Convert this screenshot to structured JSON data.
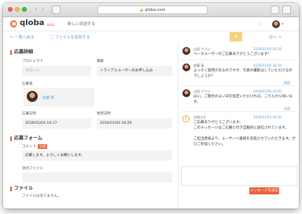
{
  "browser": {
    "url": "qloba.com"
  },
  "header": {
    "logo": "qloba",
    "beta": "beta",
    "title": "新しい対話する"
  },
  "toolbar": {
    "back_link": "← 一覧へ戻る",
    "attach_link": "🗋 ファイルを追加する",
    "next_link": "次へ >"
  },
  "detail": {
    "section_title": "応募詳細",
    "project_label": "プロジェクト",
    "project_value": "グローバ",
    "recruit_label": "募集",
    "recruit_value": "トライアルユーザーのお申し込み",
    "applicant_label": "応募者",
    "applicant_name": "佐藤 瑛",
    "applied_at_label": "応募日時",
    "applied_at_value": "2016/01/04 16:17",
    "updated_at_label": "更新日時",
    "updated_at_value": "2016/01/04 16:26"
  },
  "form": {
    "section_title": "応募フォーム",
    "comment_label": "コメント",
    "required": "必須",
    "comment_value": "応募します。よろしくお願いします。",
    "attachment_label": "添付ファイル"
  },
  "files": {
    "section_title": "ファイル",
    "empty_text": "ファイルはありません。"
  },
  "chat": {
    "messages": [
      {
        "name": "山田 ナツジ",
        "time": "2016/01/04 16:18",
        "text": "ベータユーザーのご応募ありがとうございます！"
      },
      {
        "name": "佐藤 瑛",
        "time": "2016/01/04 16:18",
        "text": "よっそく質問があるのですが、写真の撮影はしていただけるのでしょうか？",
        "status": "既読"
      },
      {
        "name": "山田 ナツジ",
        "time": "2016/01/04 16:20",
        "text": "はい。ご都合のよい日を指定いただければ、こちらから伺います。",
        "status": "未読"
      },
      {
        "name": "お知らせ",
        "time": "2016/01/04 16:26",
        "text1": "ご応募ありがとうございます。",
        "text2": "このメッセージはご応募に付き自動的に送信されています。",
        "text3": "ご担当者様より、ユーザーへ連絡を実施させていただきます。ぜひご参加ください。"
      }
    ],
    "send_label": "メッセージを送信"
  }
}
